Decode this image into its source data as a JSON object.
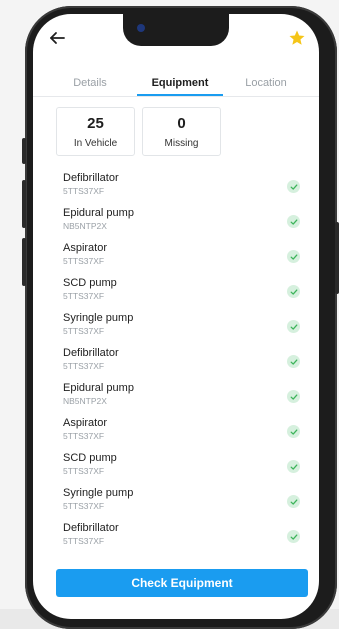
{
  "nav": {
    "back_icon": "arrow-left-icon",
    "favorite_icon": "star-icon",
    "favorite_color": "#f5c518"
  },
  "tabs": [
    {
      "label": "Details",
      "active": false
    },
    {
      "label": "Equipment",
      "active": true
    },
    {
      "label": "Location",
      "active": false
    }
  ],
  "summary": {
    "in_vehicle": {
      "value": "25",
      "label": "In Vehicle"
    },
    "missing": {
      "value": "0",
      "label": "Missing"
    }
  },
  "equipment": [
    {
      "name": "Defibrillator",
      "code": "5TTS37XF",
      "status": "check-icon"
    },
    {
      "name": "Epidural pump",
      "code": "NB5NTP2X",
      "status": "check-icon"
    },
    {
      "name": "Aspirator",
      "code": "5TTS37XF",
      "status": "check-icon"
    },
    {
      "name": "SCD pump",
      "code": "5TTS37XF",
      "status": "check-icon"
    },
    {
      "name": "Syringle pump",
      "code": "5TTS37XF",
      "status": "check-icon"
    },
    {
      "name": "Defibrillator",
      "code": "5TTS37XF",
      "status": "check-icon"
    },
    {
      "name": "Epidural pump",
      "code": "NB5NTP2X",
      "status": "check-icon"
    },
    {
      "name": "Aspirator",
      "code": "5TTS37XF",
      "status": "check-icon"
    },
    {
      "name": "SCD pump",
      "code": "5TTS37XF",
      "status": "check-icon"
    },
    {
      "name": "Syringle pump",
      "code": "5TTS37XF",
      "status": "check-icon"
    },
    {
      "name": "Defibrillator",
      "code": "5TTS37XF",
      "status": "check-icon"
    }
  ],
  "actions": {
    "check_label": "Check Equipment"
  },
  "colors": {
    "accent": "#1a9cf0",
    "check_bg": "#d6f0de",
    "check_fg": "#3cb45a"
  }
}
